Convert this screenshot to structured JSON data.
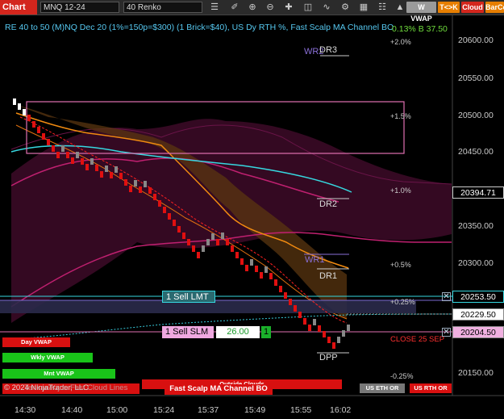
{
  "toolbar": {
    "chart_label": "Chart",
    "instrument": "MNQ 12-24",
    "interval": "40 Renko",
    "btn_wvwap": "W VWAP",
    "btn_tk": "T<>K",
    "btn_cloud": "Cloud",
    "btn_barco": "BarCo",
    "colors": {
      "chart": "#d3261d",
      "wvwap": "#9a9a9a",
      "tk": "#e67e00",
      "cloud": "#d3261d",
      "barco": "#e67e00"
    }
  },
  "chart": {
    "title": "RE 40 to 50 (M)NQ Dec 20 (1%=150p=$300) (1 Brick=$40), US Dy RTH %, Fast Scalp MA Channel BO",
    "top_value_label": "0.13% B 37.50",
    "price_axis": [
      "20600.00",
      "20550.00",
      "20500.00",
      "20450.00",
      "20350.00",
      "20300.00",
      "20150.00"
    ],
    "time_axis": [
      "14:30",
      "14:40",
      "15:00",
      "15:24",
      "15:37",
      "15:49",
      "15:55",
      "16:02"
    ],
    "pct_labels": [
      "+2.0%",
      "+1.5%",
      "+1.0%",
      "+0.5%",
      "+0.25%",
      "-0.25%"
    ],
    "levels": {
      "wr2": "WR2",
      "dr3": "DR3",
      "dr2": "DR2",
      "wr1": "WR1",
      "dr1": "DR1",
      "dpp": "DPP"
    },
    "close_label": "CLOSE 25 SEP",
    "price_tags": {
      "last": "20394.71",
      "sell_lmt_price": "20253.50",
      "current": "20229.50",
      "sell_slm_price": "20204.50"
    },
    "orders": {
      "sell_lmt": "1 Sell LMT",
      "sell_slm": "1 Sell SLM",
      "pnl": "26.00",
      "qty": "1"
    },
    "indicator_buttons": {
      "day_vwap": "Day VWAP",
      "wkly_vwap": "Wkly VWAP",
      "mnt_vwap": "Mnt VWAP",
      "outside_clouds": "Outside Clouds",
      "fast_scalp": "Fast Scalp MA Channel BO",
      "us_eth": "US ETH OR",
      "us_rth": "US RTH OR"
    },
    "copyright": "© 2024 NinjaTrader, LLC",
    "tenkan": "Tenkan/Kijun Fast Cloud Lines"
  }
}
